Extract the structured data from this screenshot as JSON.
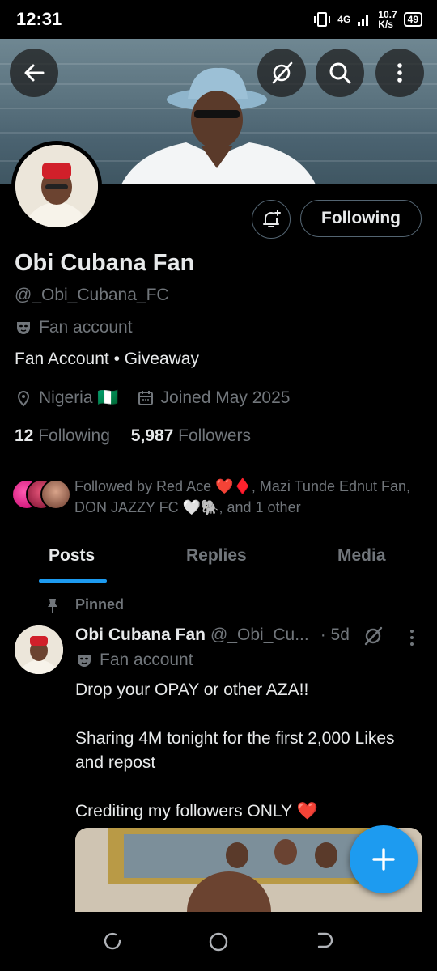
{
  "status_bar": {
    "time": "12:31",
    "network": "4G",
    "speed": "10.7",
    "speed_unit": "K/s",
    "battery": "49"
  },
  "profile": {
    "name": "Obi Cubana Fan",
    "handle": "@_Obi_Cubana_FC",
    "category": "Fan account",
    "bio": "Fan Account • Giveaway",
    "location": "Nigeria 🇳🇬",
    "joined": "Joined May 2025",
    "following_count": "12",
    "following_label": "Following",
    "followers_count": "5,987",
    "followers_label": "Followers",
    "followed_by": "Followed by Red Ace ❤️♦️, Mazi Tunde Ednut Fan, DON JAZZY FC 🤍🐘, and 1 other",
    "follow_button": "Following"
  },
  "tabs": [
    {
      "label": "Posts",
      "active": true
    },
    {
      "label": "Replies",
      "active": false
    },
    {
      "label": "Media",
      "active": false
    }
  ],
  "post": {
    "pinned_label": "Pinned",
    "author": "Obi Cubana Fan",
    "handle": "@_Obi_Cu...",
    "time": "· 5d",
    "category": "Fan account",
    "line1": "Drop your OPAY or other AZA!!",
    "line2": "Sharing 4M tonight for the first 2,000 Likes and repost",
    "line3": "Crediting my followers ONLY ❤️"
  },
  "colors": {
    "accent": "#1d9bf0",
    "secondary_text": "#71767b",
    "border": "#536471"
  },
  "icons": [
    "back-arrow-icon",
    "grok-icon",
    "search-icon",
    "more-vertical-icon",
    "bell-plus-icon",
    "mask-icon",
    "location-icon",
    "calendar-icon",
    "pin-icon",
    "plus-icon"
  ]
}
